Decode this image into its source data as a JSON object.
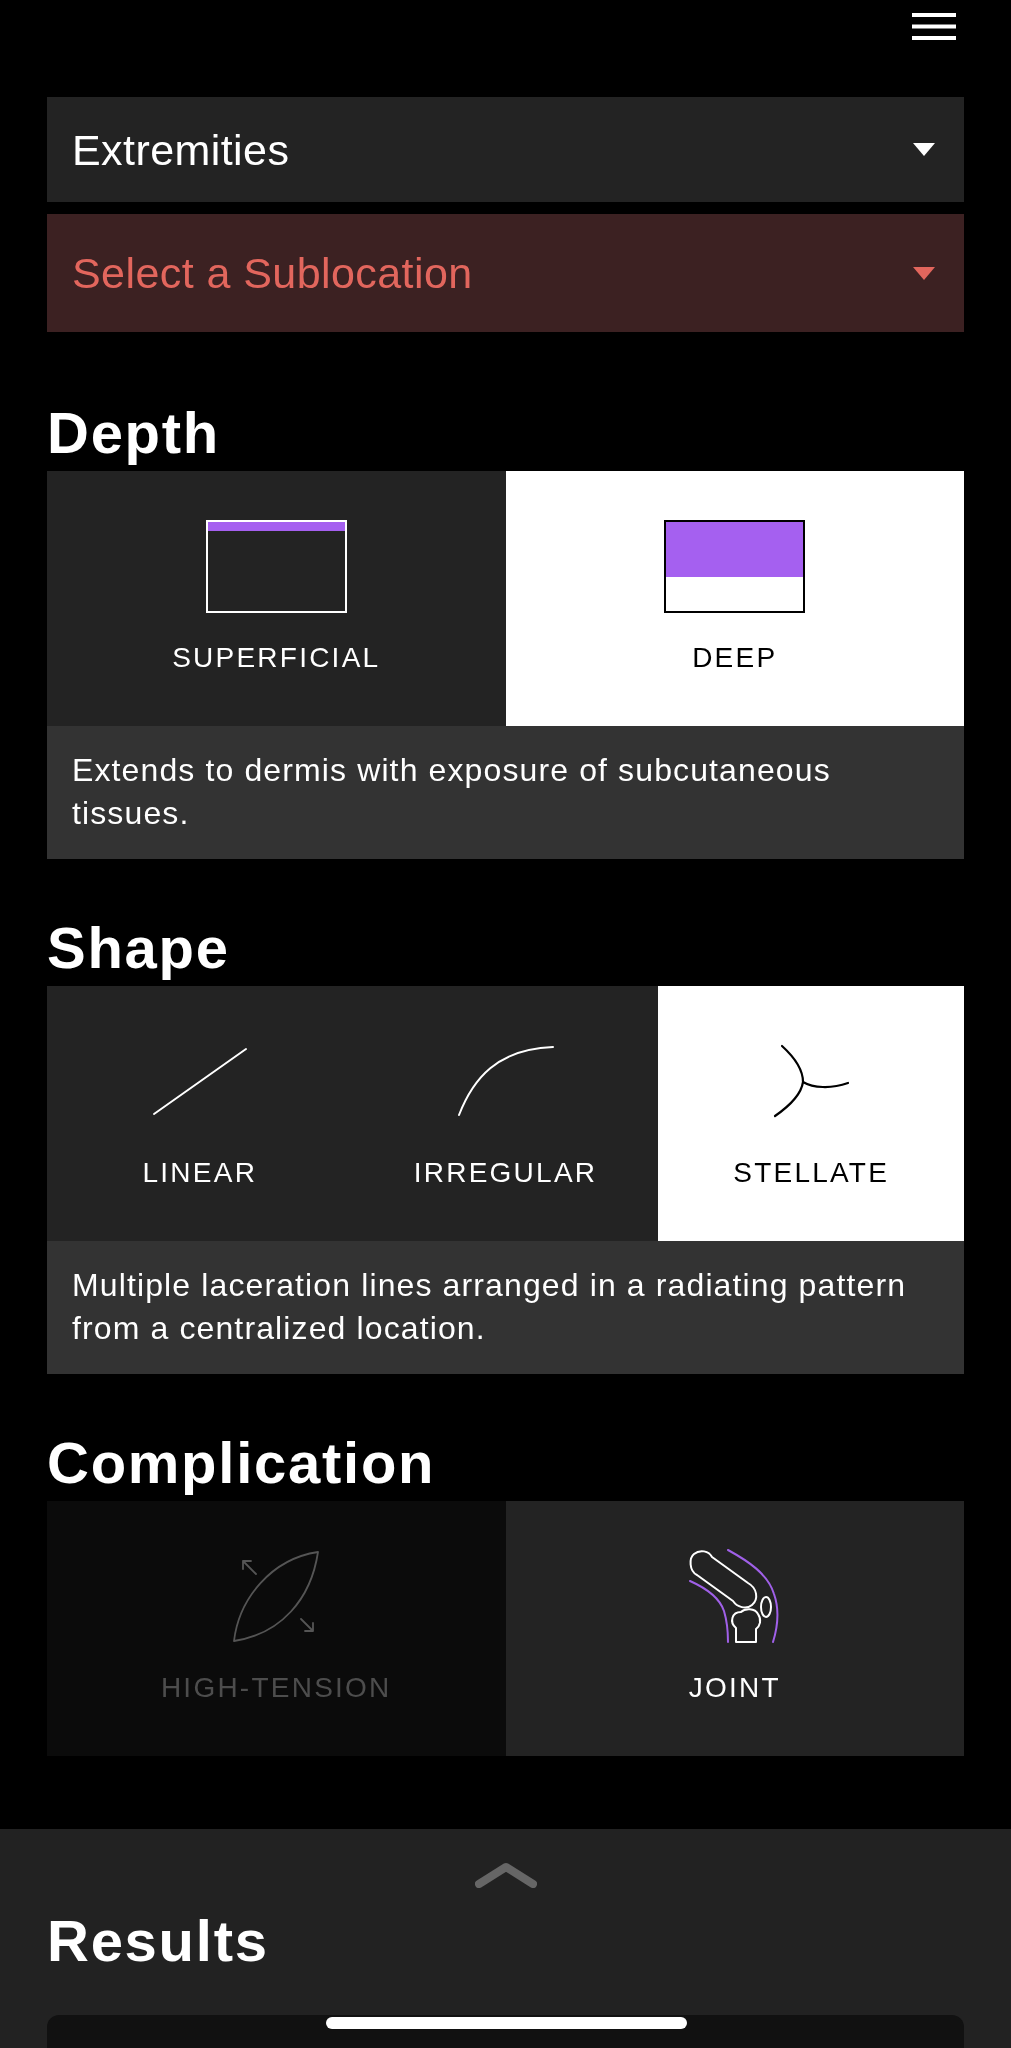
{
  "location_selects": [
    {
      "value": "Extremities",
      "invalid": false
    },
    {
      "placeholder": "Select a Sublocation",
      "invalid": true
    }
  ],
  "sections": [
    {
      "title": "Depth",
      "options": [
        {
          "label": "SUPERFICIAL",
          "kind": "superficial",
          "selected": false,
          "disabled": false
        },
        {
          "label": "DEEP",
          "kind": "deep",
          "selected": true,
          "disabled": false
        }
      ],
      "description": "Extends to dermis with exposure of subcutaneous tissues."
    },
    {
      "title": "Shape",
      "options": [
        {
          "label": "LINEAR",
          "kind": "linear",
          "selected": false,
          "disabled": false
        },
        {
          "label": "IRREGULAR",
          "kind": "irregular",
          "selected": false,
          "disabled": false
        },
        {
          "label": "STELLATE",
          "kind": "stellate",
          "selected": true,
          "disabled": false
        }
      ],
      "description": "Multiple laceration lines arranged in a radiating pattern from a centralized location."
    },
    {
      "title": "Complication",
      "options": [
        {
          "label": "HIGH-TENSION",
          "kind": "tension",
          "selected": false,
          "disabled": true
        },
        {
          "label": "JOINT",
          "kind": "joint",
          "selected": false,
          "disabled": false
        }
      ]
    }
  ],
  "results_sheet": {
    "title": "Results"
  }
}
